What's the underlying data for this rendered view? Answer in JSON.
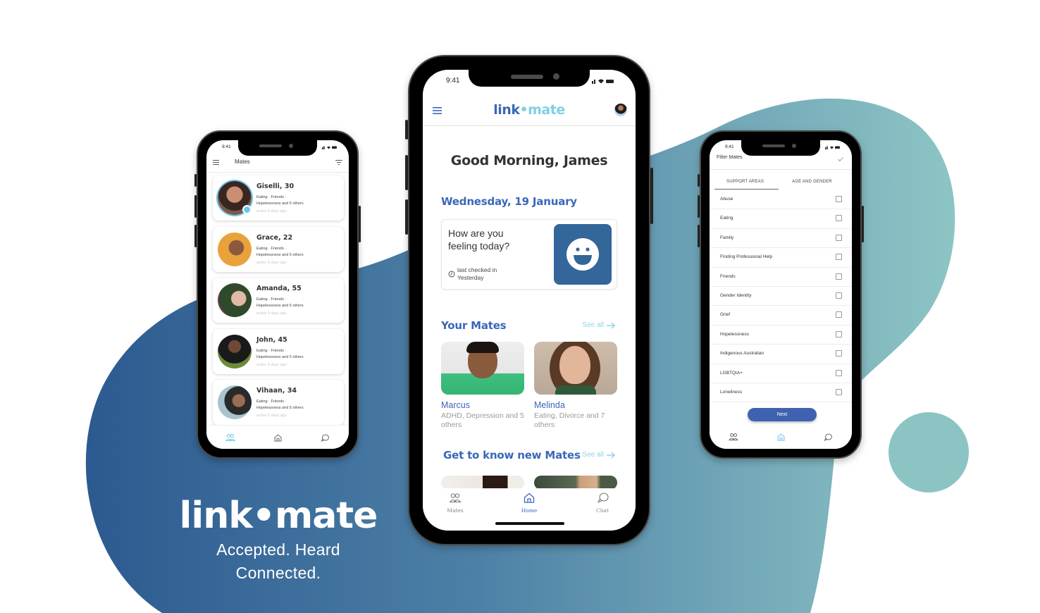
{
  "colors": {
    "brand_blue": "#3a68b8",
    "brand_light_blue": "#7fd0e4",
    "bg_dark_blue": "#2f5d92",
    "bg_teal": "#8ac4c4",
    "mood_button": "#336699",
    "next_button": "#3f62b0"
  },
  "brand": {
    "logo": "link•mate",
    "tagline_line1": "Accepted. Heard",
    "tagline_line2": "Connected."
  },
  "status_bar": {
    "time": "9:41"
  },
  "left_phone": {
    "title": "Mates",
    "menu_icon": "hamburger-icon",
    "filter_icon": "filter-icon",
    "mates": [
      {
        "name": "Giselli, 30",
        "tags_line1": "Eating · Friends ·",
        "tags_line2": "Hopelessness and 5 others",
        "active": "active 5 days ago",
        "verified": true
      },
      {
        "name": "Grace, 22",
        "tags_line1": "Eating · Friends ·",
        "tags_line2": "Hopelessness and 5 others",
        "active": "active 5 days ago"
      },
      {
        "name": "Amanda, 55",
        "tags_line1": "Eating · Friends ·",
        "tags_line2": "Hopelessness and 5 others",
        "active": "active 5 days ago"
      },
      {
        "name": "John, 45",
        "tags_line1": "Eating · Friends ·",
        "tags_line2": "Hopelessness and 5 others",
        "active": "active 5 days ago"
      },
      {
        "name": "Vihaan, 34",
        "tags_line1": "Eating · Friends ·",
        "tags_line2": "Hopelessness and 5 others",
        "active": "active 5 days ago"
      }
    ],
    "tabbar": {
      "active": "mates",
      "icons": [
        "people-icon",
        "home-icon",
        "chat-icon"
      ]
    }
  },
  "center_phone": {
    "logo_part1": "link",
    "logo_part2": "•mate",
    "greeting": "Good Morning, James",
    "date": "Wednesday, 19 January",
    "feeling_card": {
      "question": "How are you feeling today?",
      "last_checked_label": "last checked in",
      "last_checked_value": "Yesterday"
    },
    "your_mates": {
      "title": "Your Mates",
      "see_all": "See all",
      "mates": [
        {
          "name": "Marcus",
          "desc": "ADHD, Depression and 5 others"
        },
        {
          "name": "Melinda",
          "desc": "Eating, Divorce and 7 others"
        }
      ]
    },
    "new_mates": {
      "title": "Get to know new Mates",
      "see_all": "See all"
    },
    "tabbar": {
      "tabs": [
        {
          "label": "Mates",
          "icon": "people-icon"
        },
        {
          "label": "Home",
          "icon": "home-icon",
          "active": true
        },
        {
          "label": "Chat",
          "icon": "chat-icon"
        }
      ]
    }
  },
  "right_phone": {
    "title": "Filter Mates",
    "confirm_icon": "check-icon",
    "tabs": [
      {
        "label": "SUPPORT AREAS",
        "active": true
      },
      {
        "label": "AGE AND GENDER",
        "active": false
      }
    ],
    "filters": [
      {
        "label": "Abuse",
        "checked": false
      },
      {
        "label": "Eating",
        "checked": false
      },
      {
        "label": "Family",
        "checked": false
      },
      {
        "label": "Finding Professional Help",
        "checked": false
      },
      {
        "label": "Friends",
        "checked": false
      },
      {
        "label": "Gender Identity",
        "checked": false
      },
      {
        "label": "Grief",
        "checked": false
      },
      {
        "label": "Hopelessness",
        "checked": false
      },
      {
        "label": "Indigenous Australian",
        "checked": false
      },
      {
        "label": "LGBTQIA+",
        "checked": false
      },
      {
        "label": "Loneliness",
        "checked": false
      }
    ],
    "next_label": "Next",
    "tabbar": {
      "active": "home"
    }
  }
}
